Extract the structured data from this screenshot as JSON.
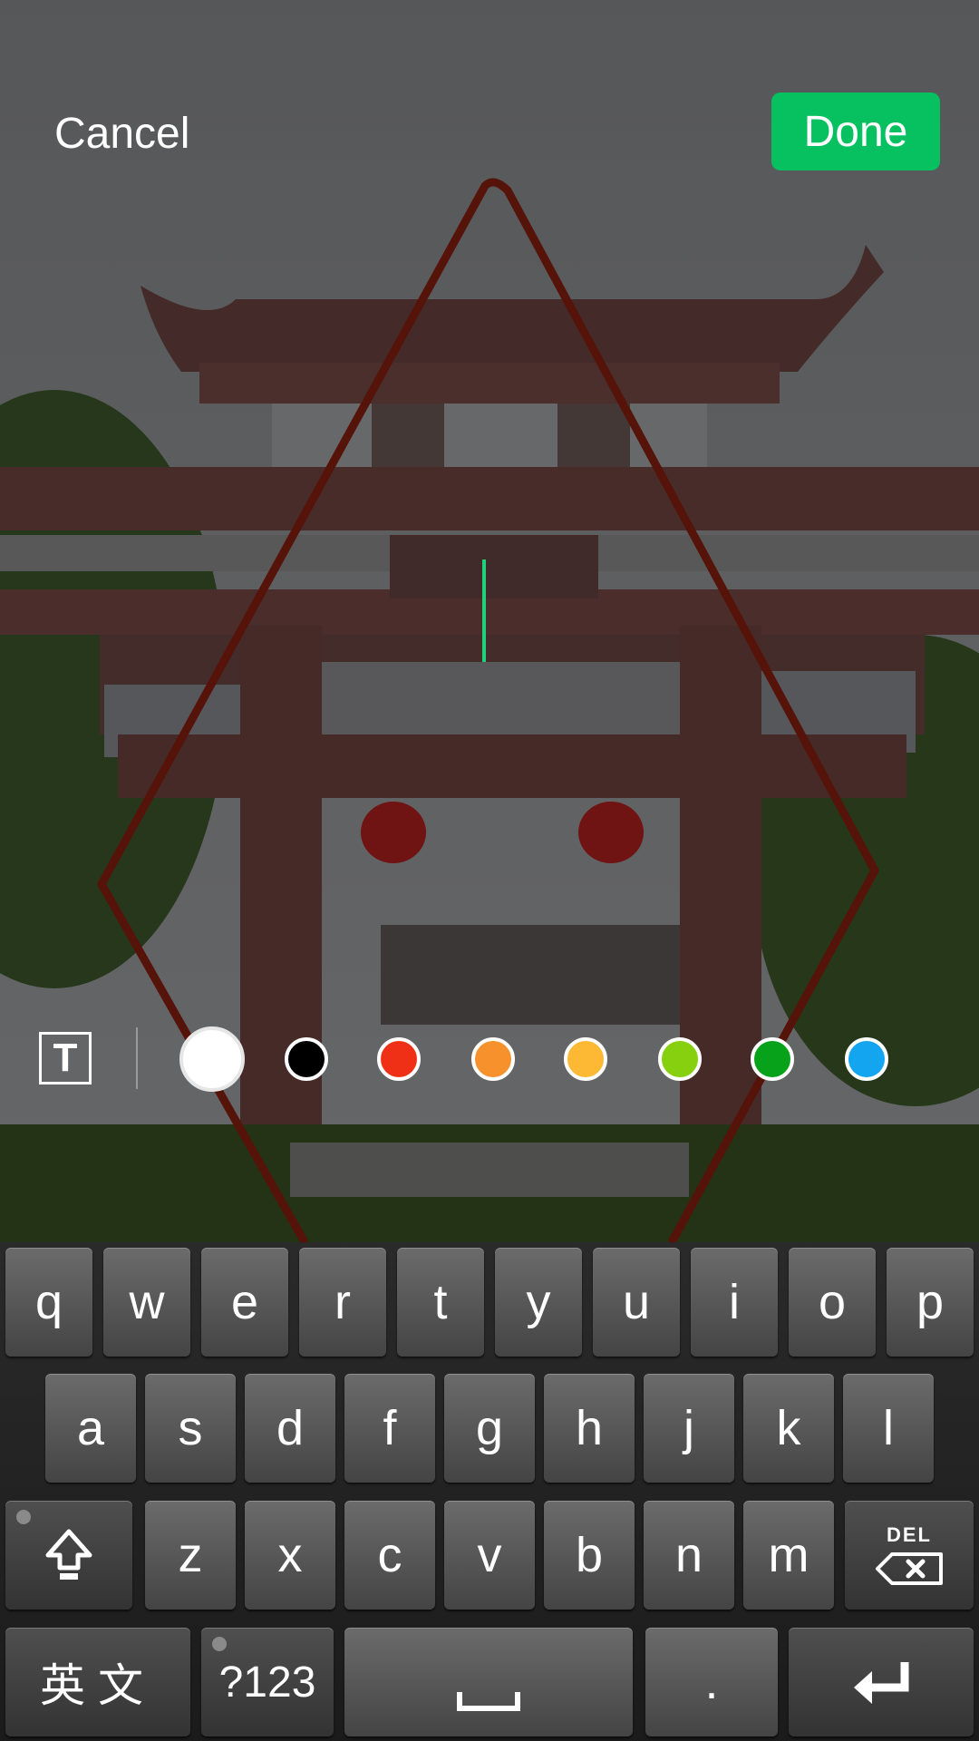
{
  "topbar": {
    "cancel_label": "Cancel",
    "done_label": "Done",
    "done_color": "#07c160"
  },
  "annotation": {
    "stroke_color": "#8a1f0f",
    "shape": "diamond"
  },
  "toolbar": {
    "text_tool_label": "T",
    "colors": [
      "#ffffff",
      "#000000",
      "#f03016",
      "#f6912c",
      "#fdb933",
      "#86d00f",
      "#08a21a",
      "#13a5f0"
    ],
    "selected_color": "#ffffff"
  },
  "keyboard": {
    "row1": [
      "q",
      "w",
      "e",
      "r",
      "t",
      "y",
      "u",
      "i",
      "o",
      "p"
    ],
    "row2": [
      "a",
      "s",
      "d",
      "f",
      "g",
      "h",
      "j",
      "k",
      "l"
    ],
    "row3": [
      "z",
      "x",
      "c",
      "v",
      "b",
      "n",
      "m"
    ],
    "shift_icon": "shift-arrow-icon",
    "del_label": "DEL",
    "lang_label": "英文",
    "symbols_label": "?123",
    "space_icon": "space-bar-icon",
    "period_label": ".",
    "enter_icon": "enter-return-icon"
  }
}
